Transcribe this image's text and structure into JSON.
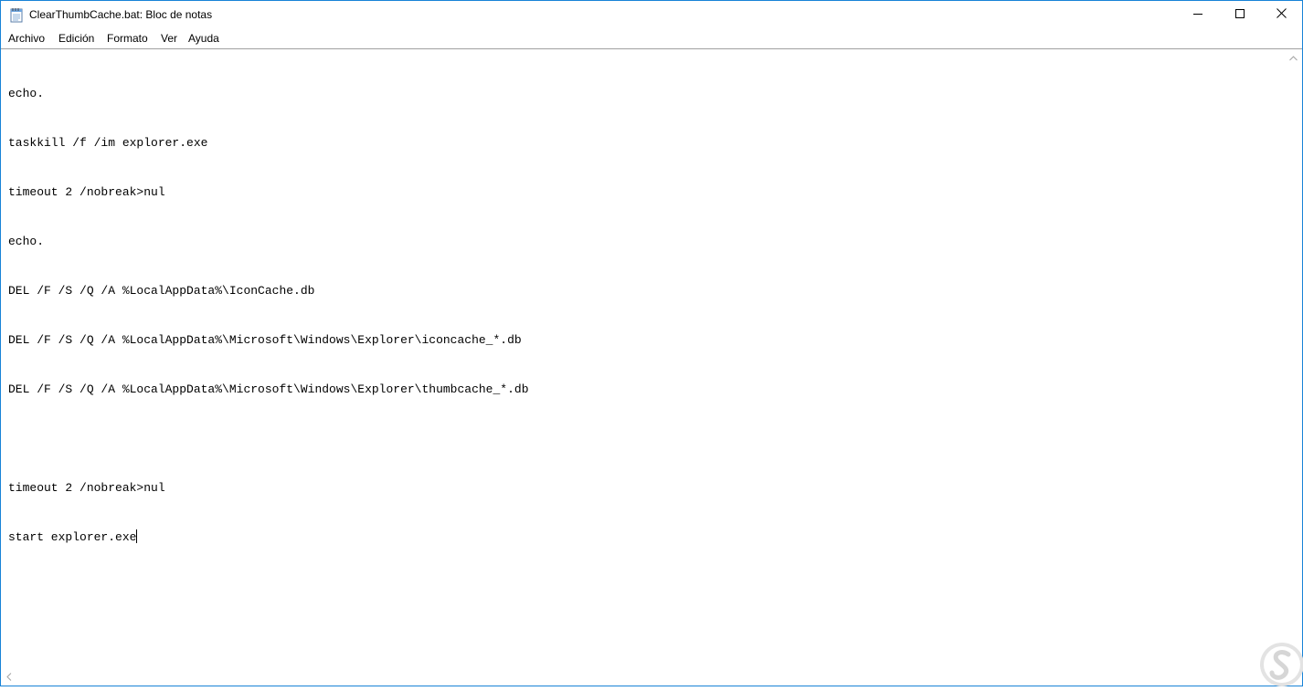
{
  "window": {
    "title": "ClearThumbCache.bat: Bloc de notas",
    "icon": "notepad-icon",
    "controls": {
      "minimize_icon": "minimize-icon",
      "maximize_icon": "maximize-icon",
      "close_icon": "close-icon"
    }
  },
  "menu": {
    "items": [
      {
        "label": "Archivo"
      },
      {
        "label": "Edición"
      },
      {
        "label": "Formato"
      },
      {
        "label": "Ver"
      },
      {
        "label": "Ayuda"
      }
    ]
  },
  "editor": {
    "lines": [
      "echo.",
      "taskkill /f /im explorer.exe",
      "timeout 2 /nobreak>nul",
      "echo.",
      "DEL /F /S /Q /A %LocalAppData%\\IconCache.db",
      "DEL /F /S /Q /A %LocalAppData%\\Microsoft\\Windows\\Explorer\\iconcache_*.db",
      "DEL /F /S /Q /A %LocalAppData%\\Microsoft\\Windows\\Explorer\\thumbcache_*.db",
      "",
      "timeout 2 /nobreak>nul",
      "start explorer.exe"
    ]
  },
  "colors": {
    "window_border": "#1883d7",
    "background": "#ffffff",
    "text": "#000000",
    "watermark": "#e6e6e6"
  },
  "watermark": {
    "icon": "site-logo-icon"
  }
}
